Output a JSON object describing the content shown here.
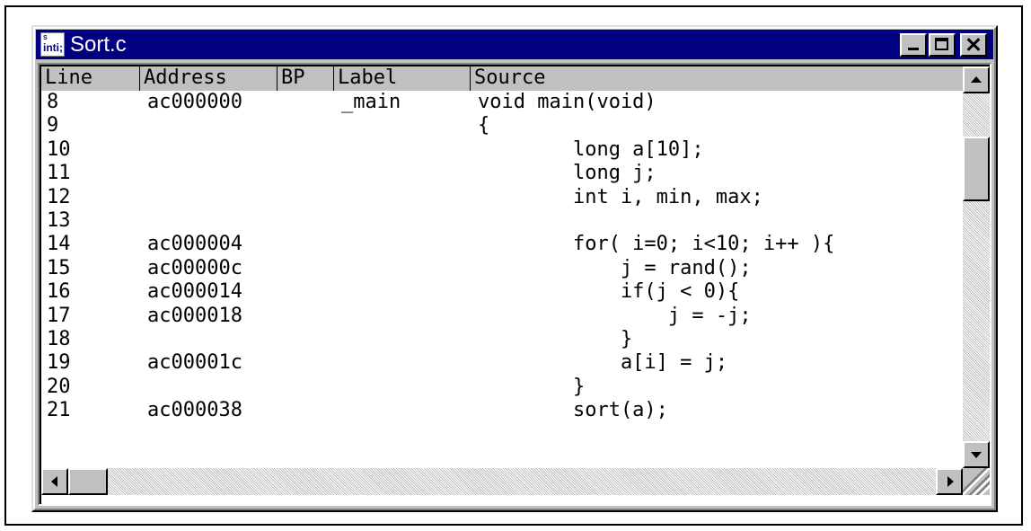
{
  "window": {
    "title": "Sort.c",
    "icon_text_small": "S",
    "icon_text_large": "inti;"
  },
  "columns": {
    "line": "Line",
    "address": "Address",
    "bp": "BP",
    "label": "Label",
    "source": "Source"
  },
  "rows": [
    {
      "line": "8",
      "address": "ac000000",
      "label": "_main",
      "source": "void main(void)"
    },
    {
      "line": "9",
      "address": "",
      "label": "",
      "source": "{"
    },
    {
      "line": "10",
      "address": "",
      "label": "",
      "source": "        long a[10];"
    },
    {
      "line": "11",
      "address": "",
      "label": "",
      "source": "        long j;"
    },
    {
      "line": "12",
      "address": "",
      "label": "",
      "source": "        int i, min, max;"
    },
    {
      "line": "13",
      "address": "",
      "label": "",
      "source": ""
    },
    {
      "line": "14",
      "address": "ac000004",
      "label": "",
      "source": "        for( i=0; i<10; i++ ){"
    },
    {
      "line": "15",
      "address": "ac00000c",
      "label": "",
      "source": "            j = rand();"
    },
    {
      "line": "16",
      "address": "ac000014",
      "label": "",
      "source": "            if(j < 0){"
    },
    {
      "line": "17",
      "address": "ac000018",
      "label": "",
      "source": "                j = -j;"
    },
    {
      "line": "18",
      "address": "",
      "label": "",
      "source": "            }"
    },
    {
      "line": "19",
      "address": "ac00001c",
      "label": "",
      "source": "            a[i] = j;"
    },
    {
      "line": "20",
      "address": "",
      "label": "",
      "source": "        }"
    },
    {
      "line": "21",
      "address": "ac000038",
      "label": "",
      "source": "        sort(a);"
    }
  ],
  "colors": {
    "titlebar": "#000080",
    "face": "#c0c0c0"
  }
}
